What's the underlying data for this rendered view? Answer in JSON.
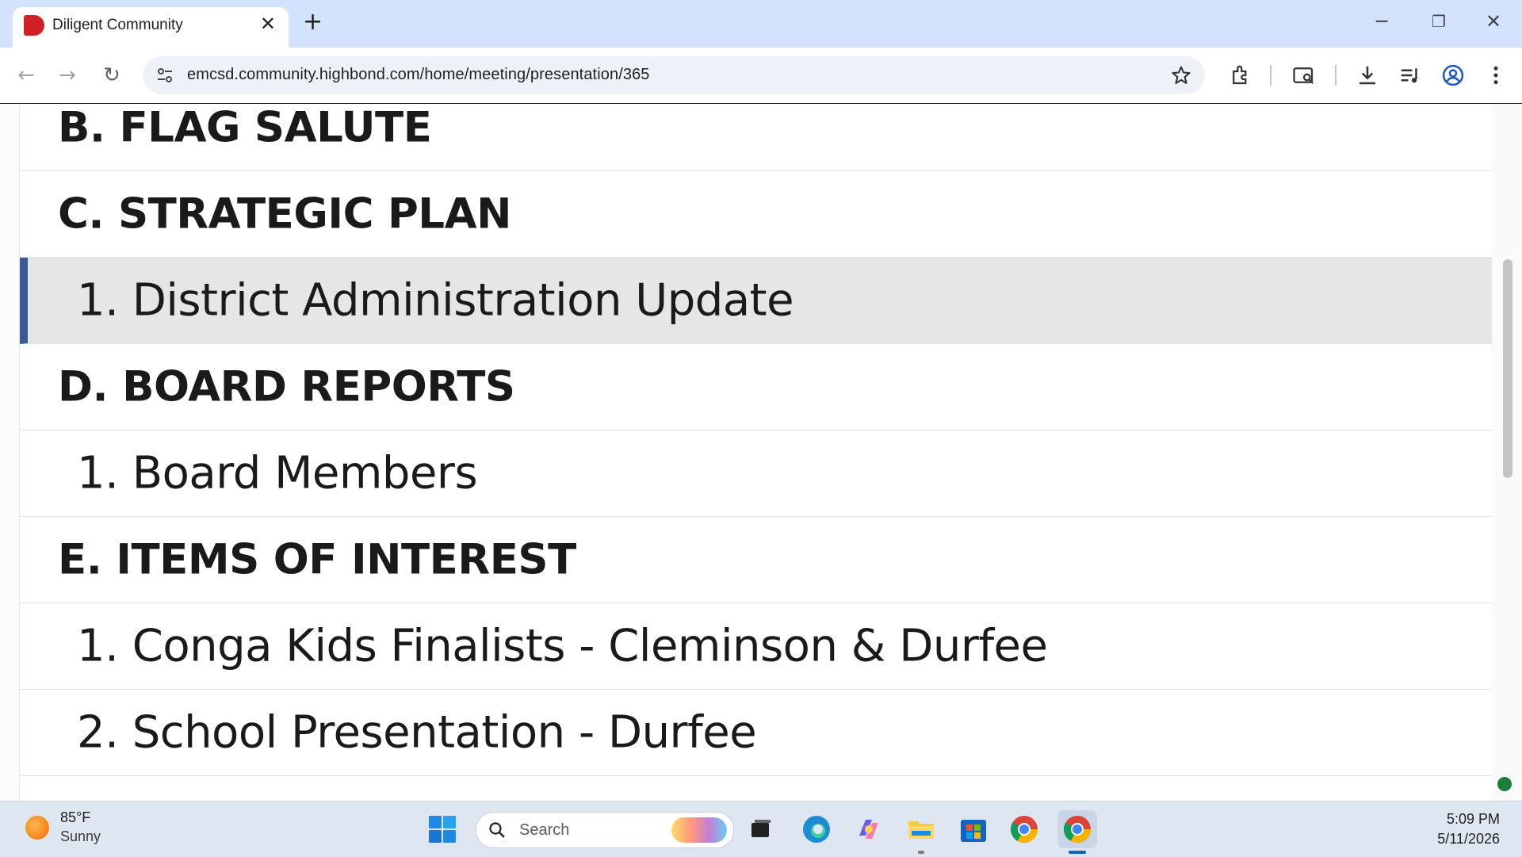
{
  "browser": {
    "tab_title": "Diligent Community",
    "close_glyph": "✕",
    "new_tab_glyph": "+",
    "url": "emcsd.community.highbond.com/home/meeting/presentation/365",
    "window_controls": {
      "minimize": "─",
      "restore": "❐",
      "close": "✕"
    },
    "nav": {
      "back": "←",
      "forward": "→",
      "reload": "↻"
    }
  },
  "agenda": {
    "rows": [
      {
        "kind": "section",
        "text": "B. FLAG SALUTE"
      },
      {
        "kind": "section",
        "text": "C. STRATEGIC PLAN"
      },
      {
        "kind": "item",
        "text": "1. District Administration Update",
        "selected": true
      },
      {
        "kind": "section",
        "text": "D. BOARD REPORTS"
      },
      {
        "kind": "item",
        "text": "1. Board Members"
      },
      {
        "kind": "section",
        "text": "E. ITEMS OF INTEREST"
      },
      {
        "kind": "item",
        "text": "1. Conga Kids Finalists - Cleminson & Durfee"
      },
      {
        "kind": "item",
        "text": "2. School Presentation - Durfee"
      }
    ]
  },
  "taskbar": {
    "weather_temp": "85°F",
    "weather_condition": "Sunny",
    "search_placeholder": "Search",
    "time": "5:09 PM",
    "date": "5/11/2026"
  },
  "colors": {
    "selected_accent": "#3b5998",
    "favicon": "#d22027",
    "tabstrip": "#d3e3fd"
  }
}
